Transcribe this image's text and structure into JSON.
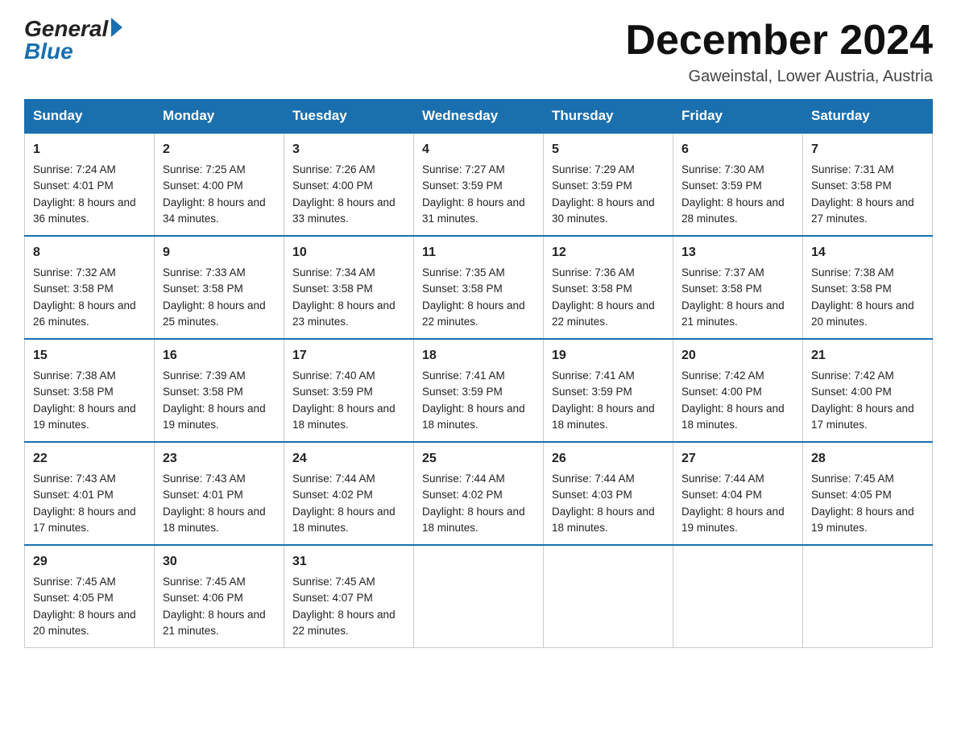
{
  "logo": {
    "general": "General",
    "blue": "Blue"
  },
  "title": "December 2024",
  "location": "Gaweinstal, Lower Austria, Austria",
  "days_of_week": [
    "Sunday",
    "Monday",
    "Tuesday",
    "Wednesday",
    "Thursday",
    "Friday",
    "Saturday"
  ],
  "weeks": [
    [
      {
        "day": "1",
        "sunrise": "7:24 AM",
        "sunset": "4:01 PM",
        "daylight": "8 hours and 36 minutes."
      },
      {
        "day": "2",
        "sunrise": "7:25 AM",
        "sunset": "4:00 PM",
        "daylight": "8 hours and 34 minutes."
      },
      {
        "day": "3",
        "sunrise": "7:26 AM",
        "sunset": "4:00 PM",
        "daylight": "8 hours and 33 minutes."
      },
      {
        "day": "4",
        "sunrise": "7:27 AM",
        "sunset": "3:59 PM",
        "daylight": "8 hours and 31 minutes."
      },
      {
        "day": "5",
        "sunrise": "7:29 AM",
        "sunset": "3:59 PM",
        "daylight": "8 hours and 30 minutes."
      },
      {
        "day": "6",
        "sunrise": "7:30 AM",
        "sunset": "3:59 PM",
        "daylight": "8 hours and 28 minutes."
      },
      {
        "day": "7",
        "sunrise": "7:31 AM",
        "sunset": "3:58 PM",
        "daylight": "8 hours and 27 minutes."
      }
    ],
    [
      {
        "day": "8",
        "sunrise": "7:32 AM",
        "sunset": "3:58 PM",
        "daylight": "8 hours and 26 minutes."
      },
      {
        "day": "9",
        "sunrise": "7:33 AM",
        "sunset": "3:58 PM",
        "daylight": "8 hours and 25 minutes."
      },
      {
        "day": "10",
        "sunrise": "7:34 AM",
        "sunset": "3:58 PM",
        "daylight": "8 hours and 23 minutes."
      },
      {
        "day": "11",
        "sunrise": "7:35 AM",
        "sunset": "3:58 PM",
        "daylight": "8 hours and 22 minutes."
      },
      {
        "day": "12",
        "sunrise": "7:36 AM",
        "sunset": "3:58 PM",
        "daylight": "8 hours and 22 minutes."
      },
      {
        "day": "13",
        "sunrise": "7:37 AM",
        "sunset": "3:58 PM",
        "daylight": "8 hours and 21 minutes."
      },
      {
        "day": "14",
        "sunrise": "7:38 AM",
        "sunset": "3:58 PM",
        "daylight": "8 hours and 20 minutes."
      }
    ],
    [
      {
        "day": "15",
        "sunrise": "7:38 AM",
        "sunset": "3:58 PM",
        "daylight": "8 hours and 19 minutes."
      },
      {
        "day": "16",
        "sunrise": "7:39 AM",
        "sunset": "3:58 PM",
        "daylight": "8 hours and 19 minutes."
      },
      {
        "day": "17",
        "sunrise": "7:40 AM",
        "sunset": "3:59 PM",
        "daylight": "8 hours and 18 minutes."
      },
      {
        "day": "18",
        "sunrise": "7:41 AM",
        "sunset": "3:59 PM",
        "daylight": "8 hours and 18 minutes."
      },
      {
        "day": "19",
        "sunrise": "7:41 AM",
        "sunset": "3:59 PM",
        "daylight": "8 hours and 18 minutes."
      },
      {
        "day": "20",
        "sunrise": "7:42 AM",
        "sunset": "4:00 PM",
        "daylight": "8 hours and 18 minutes."
      },
      {
        "day": "21",
        "sunrise": "7:42 AM",
        "sunset": "4:00 PM",
        "daylight": "8 hours and 17 minutes."
      }
    ],
    [
      {
        "day": "22",
        "sunrise": "7:43 AM",
        "sunset": "4:01 PM",
        "daylight": "8 hours and 17 minutes."
      },
      {
        "day": "23",
        "sunrise": "7:43 AM",
        "sunset": "4:01 PM",
        "daylight": "8 hours and 18 minutes."
      },
      {
        "day": "24",
        "sunrise": "7:44 AM",
        "sunset": "4:02 PM",
        "daylight": "8 hours and 18 minutes."
      },
      {
        "day": "25",
        "sunrise": "7:44 AM",
        "sunset": "4:02 PM",
        "daylight": "8 hours and 18 minutes."
      },
      {
        "day": "26",
        "sunrise": "7:44 AM",
        "sunset": "4:03 PM",
        "daylight": "8 hours and 18 minutes."
      },
      {
        "day": "27",
        "sunrise": "7:44 AM",
        "sunset": "4:04 PM",
        "daylight": "8 hours and 19 minutes."
      },
      {
        "day": "28",
        "sunrise": "7:45 AM",
        "sunset": "4:05 PM",
        "daylight": "8 hours and 19 minutes."
      }
    ],
    [
      {
        "day": "29",
        "sunrise": "7:45 AM",
        "sunset": "4:05 PM",
        "daylight": "8 hours and 20 minutes."
      },
      {
        "day": "30",
        "sunrise": "7:45 AM",
        "sunset": "4:06 PM",
        "daylight": "8 hours and 21 minutes."
      },
      {
        "day": "31",
        "sunrise": "7:45 AM",
        "sunset": "4:07 PM",
        "daylight": "8 hours and 22 minutes."
      },
      null,
      null,
      null,
      null
    ]
  ]
}
